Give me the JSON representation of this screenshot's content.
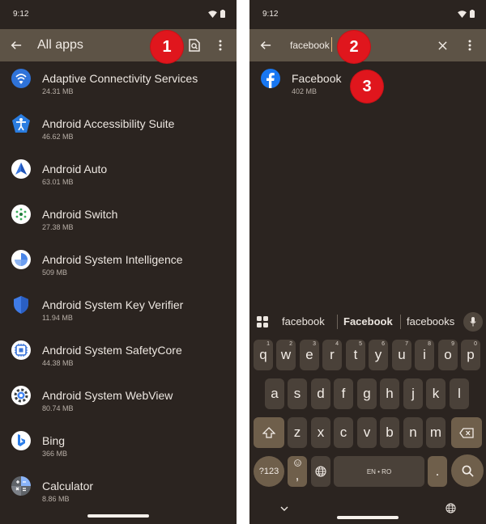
{
  "left": {
    "status": {
      "time": "9:12"
    },
    "app_bar": {
      "title": "All apps"
    },
    "apps": [
      {
        "name": "Adaptive Connectivity Services",
        "size": "24.31 MB",
        "icon": "adaptive-connectivity-icon"
      },
      {
        "name": "Android Accessibility Suite",
        "size": "46.62 MB",
        "icon": "accessibility-icon"
      },
      {
        "name": "Android Auto",
        "size": "63.01 MB",
        "icon": "android-auto-icon"
      },
      {
        "name": "Android Switch",
        "size": "27.38 MB",
        "icon": "android-switch-icon"
      },
      {
        "name": "Android System Intelligence",
        "size": "509 MB",
        "icon": "system-intelligence-icon"
      },
      {
        "name": "Android System Key Verifier",
        "size": "11.94 MB",
        "icon": "key-verifier-shield-icon"
      },
      {
        "name": "Android System SafetyCore",
        "size": "44.38 MB",
        "icon": "safetycore-icon"
      },
      {
        "name": "Android System WebView",
        "size": "80.74 MB",
        "icon": "webview-gear-icon"
      },
      {
        "name": "Bing",
        "size": "366 MB",
        "icon": "bing-icon"
      },
      {
        "name": "Calculator",
        "size": "8.86 MB",
        "icon": "calculator-icon"
      }
    ],
    "badge": "1"
  },
  "right": {
    "status": {
      "time": "9:12"
    },
    "search": {
      "value": "facebook"
    },
    "result": {
      "name": "Facebook",
      "size": "402 MB",
      "icon": "facebook-icon"
    },
    "badges": [
      "2",
      "3"
    ],
    "keyboard": {
      "suggestions": [
        "facebook",
        "Facebook",
        "facebooks"
      ],
      "row1": [
        {
          "k": "q",
          "h": "1"
        },
        {
          "k": "w",
          "h": "2"
        },
        {
          "k": "e",
          "h": "3"
        },
        {
          "k": "r",
          "h": "4"
        },
        {
          "k": "t",
          "h": "5"
        },
        {
          "k": "y",
          "h": "6"
        },
        {
          "k": "u",
          "h": "7"
        },
        {
          "k": "i",
          "h": "8"
        },
        {
          "k": "o",
          "h": "9"
        },
        {
          "k": "p",
          "h": "0"
        }
      ],
      "row2": [
        "a",
        "s",
        "d",
        "f",
        "g",
        "h",
        "j",
        "k",
        "l"
      ],
      "row3": [
        "z",
        "x",
        "c",
        "v",
        "b",
        "n",
        "m"
      ],
      "symbols_label": "?123",
      "comma": ",",
      "space_label": "EN • RO",
      "period": "."
    }
  },
  "colors": {
    "background": "#2b2420",
    "app_bar": "#5d5346",
    "badge": "#e0161d",
    "key": "#4a4139",
    "key_accent": "#6f5f4b"
  }
}
